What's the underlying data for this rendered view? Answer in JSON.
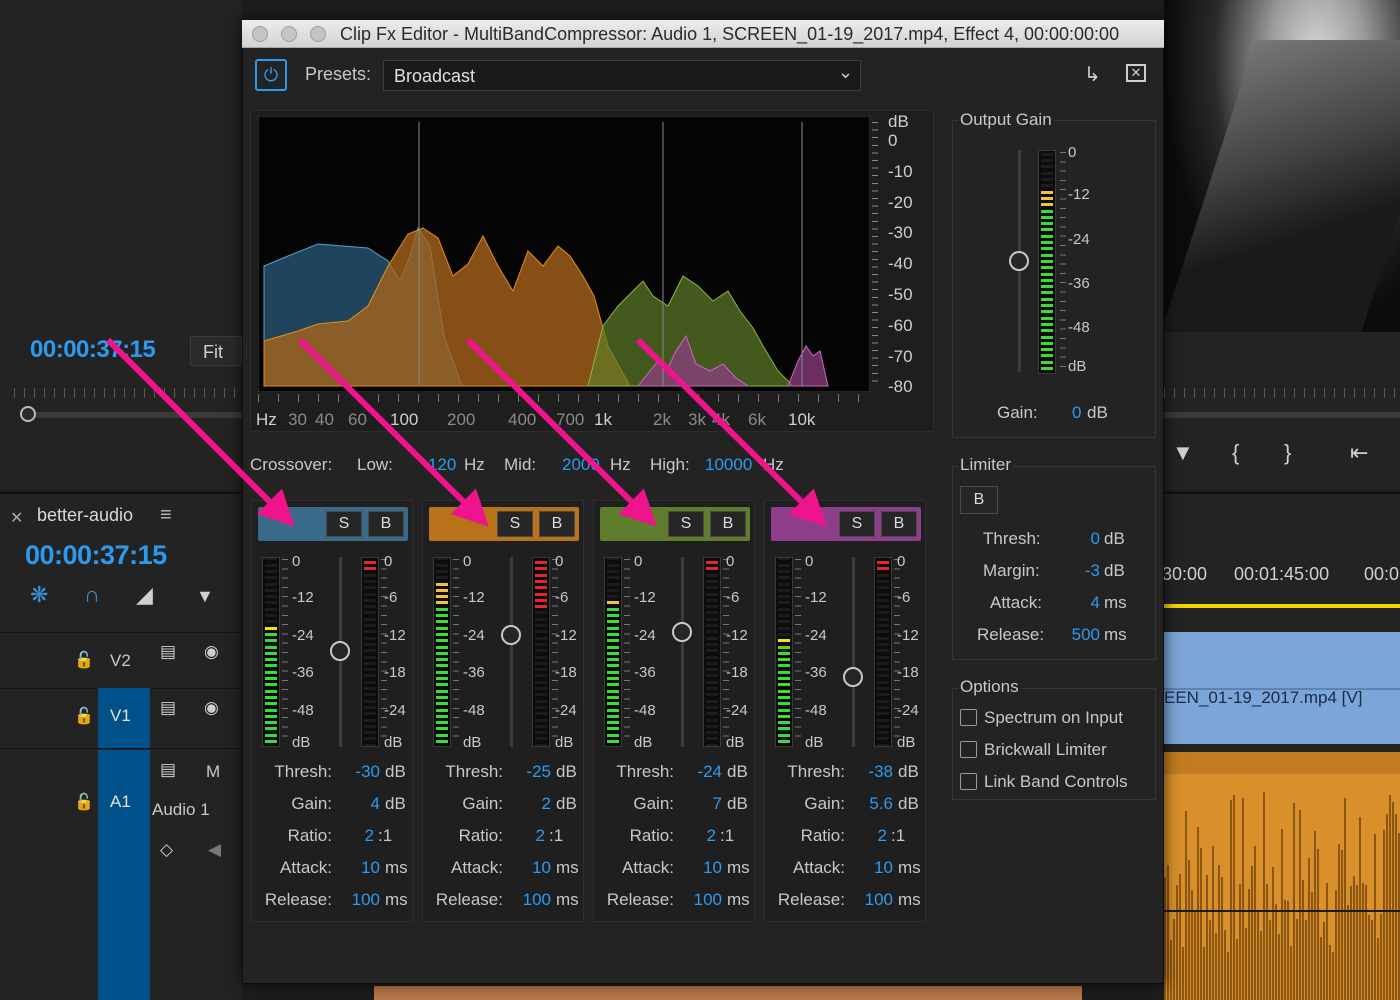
{
  "background": {
    "program_timecode": "00:00:37:15",
    "fit_label": "Fit",
    "sequence_name": "better-audio",
    "sequence_timecode": "00:00:37:15",
    "tracks": [
      {
        "id": "V2",
        "label": "V2"
      },
      {
        "id": "V1",
        "label": "V1"
      },
      {
        "id": "A1",
        "label": "A1",
        "name": "Audio 1",
        "mute_label": "M"
      }
    ],
    "timeline_times": [
      "30:00",
      "00:01:45:00",
      "00:0"
    ],
    "clip_label": "EEN_01-19_2017.mp4 [V]"
  },
  "window": {
    "title": "Clip Fx Editor - MultiBandCompressor: Audio 1, SCREEN_01-19_2017.mp4, Effect 4, 00:00:00:00",
    "presets_label": "Presets:",
    "preset_value": "Broadcast"
  },
  "spectrum": {
    "db_unit": "dB",
    "db_labels": [
      "0",
      "-10",
      "-20",
      "-30",
      "-40",
      "-50",
      "-60",
      "-70",
      "-80"
    ],
    "hz_unit": "Hz",
    "hz_labels": [
      "30",
      "40",
      "60",
      "100",
      "200",
      "400",
      "700",
      "1k",
      "2k",
      "3k",
      "4k",
      "6k",
      "10k"
    ]
  },
  "crossover": {
    "label": "Crossover:",
    "low_label": "Low:",
    "low_value": "120",
    "low_unit": "Hz",
    "mid_label": "Mid:",
    "mid_value": "2000",
    "mid_unit": "Hz",
    "high_label": "High:",
    "high_value": "10000",
    "high_unit": "Hz"
  },
  "param_labels": {
    "thresh": "Thresh:",
    "gain": "Gain:",
    "ratio": "Ratio:",
    "attack": "Attack:",
    "release": "Release:"
  },
  "units": {
    "db": "dB",
    "ratio": ":1",
    "ms": "ms"
  },
  "meter_scale_left": [
    "0",
    "-12",
    "-24",
    "-36",
    "-48",
    "dB"
  ],
  "meter_scale_right": [
    "0",
    "-6",
    "-12",
    "-18",
    "-24",
    "dB"
  ],
  "solo_label": "S",
  "bypass_label": "B",
  "colors": {
    "accent": "#2b9bf0",
    "band1": "#3a6a8a",
    "band2": "#b8731a",
    "band3": "#5f7d2c",
    "band4": "#8e3d8a",
    "arrow": "#f0148c"
  },
  "bands": [
    {
      "name": "band-1",
      "thresh": "-30",
      "gain": "4",
      "ratio": "2",
      "attack": "10",
      "release": "100",
      "input_level": 0.63,
      "gr_level": 0.05
    },
    {
      "name": "band-2",
      "thresh": "-25",
      "gain": "2",
      "ratio": "2",
      "attack": "10",
      "release": "100",
      "input_level": 0.85,
      "gr_level": 0.25
    },
    {
      "name": "band-3",
      "thresh": "-24",
      "gain": "7",
      "ratio": "2",
      "attack": "10",
      "release": "100",
      "input_level": 0.77,
      "gr_level": 0.05
    },
    {
      "name": "band-4",
      "thresh": "-38",
      "gain": "5.6",
      "ratio": "2",
      "attack": "10",
      "release": "100",
      "input_level": 0.58,
      "gr_level": 0.05
    }
  ],
  "output_gain": {
    "title": "Output Gain",
    "scale": [
      "0",
      "-12",
      "-24",
      "-36",
      "-48",
      "dB"
    ],
    "gain_label": "Gain:",
    "gain_value": "0",
    "unit": "dB",
    "level": 0.83
  },
  "limiter": {
    "title": "Limiter",
    "bypass_label": "B",
    "thresh_label": "Thresh:",
    "thresh_value": "0",
    "thresh_unit": "dB",
    "margin_label": "Margin:",
    "margin_value": "-3",
    "margin_unit": "dB",
    "attack_label": "Attack:",
    "attack_value": "4",
    "attack_unit": "ms",
    "release_label": "Release:",
    "release_value": "500",
    "release_unit": "ms"
  },
  "options": {
    "title": "Options",
    "items": [
      {
        "label": "Spectrum on Input",
        "checked": false
      },
      {
        "label": "Brickwall Limiter",
        "checked": false
      },
      {
        "label": "Link Band Controls",
        "checked": false
      }
    ]
  }
}
